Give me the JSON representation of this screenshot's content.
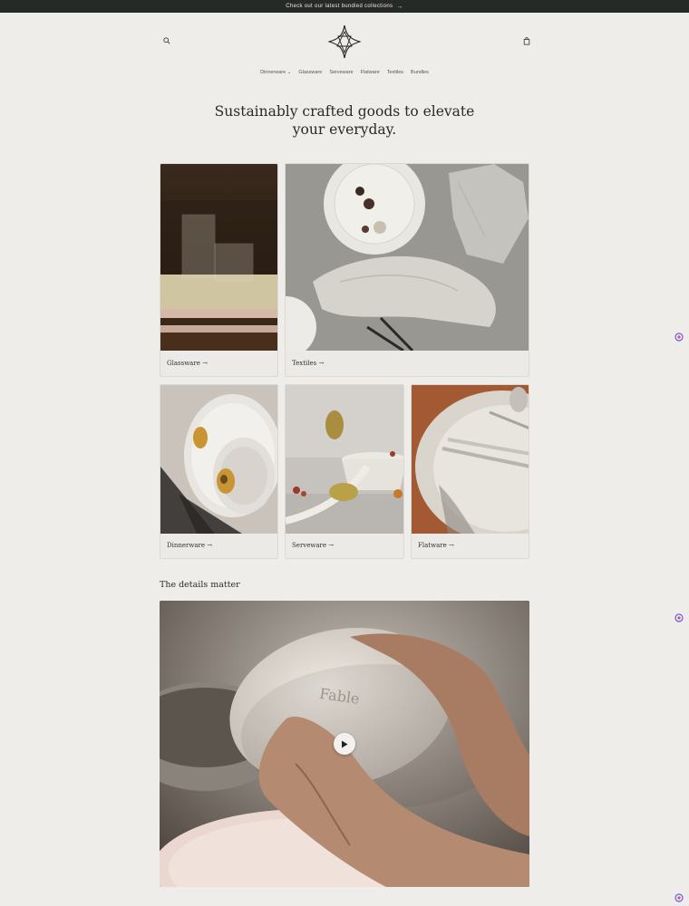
{
  "announcement": {
    "text": "Check out our latest bundled collections",
    "arrow": "→"
  },
  "header": {
    "search_icon": "search-icon",
    "cart_icon": "cart-icon",
    "logo": "star-diamond-logo"
  },
  "nav": {
    "items": [
      {
        "label": "Dinnerware",
        "has_dropdown": true,
        "chevron": "⌄"
      },
      {
        "label": "Glassware"
      },
      {
        "label": "Serveware"
      },
      {
        "label": "Flatware"
      },
      {
        "label": "Textiles"
      },
      {
        "label": "Bundles"
      }
    ]
  },
  "hero": {
    "line1": "Sustainably crafted goods to elevate",
    "line2": "your everyday."
  },
  "collections": [
    {
      "label": "Glassware →"
    },
    {
      "label": "Textiles →"
    },
    {
      "label": "Dinnerware →"
    },
    {
      "label": "Serveware →"
    },
    {
      "label": "Flatware →"
    }
  ],
  "details": {
    "title": "The details matter",
    "embossed_text": "Fable"
  },
  "colors": {
    "announcement_bg": "#262a26",
    "page_bg": "#efedea",
    "text": "#2b2b2b"
  }
}
